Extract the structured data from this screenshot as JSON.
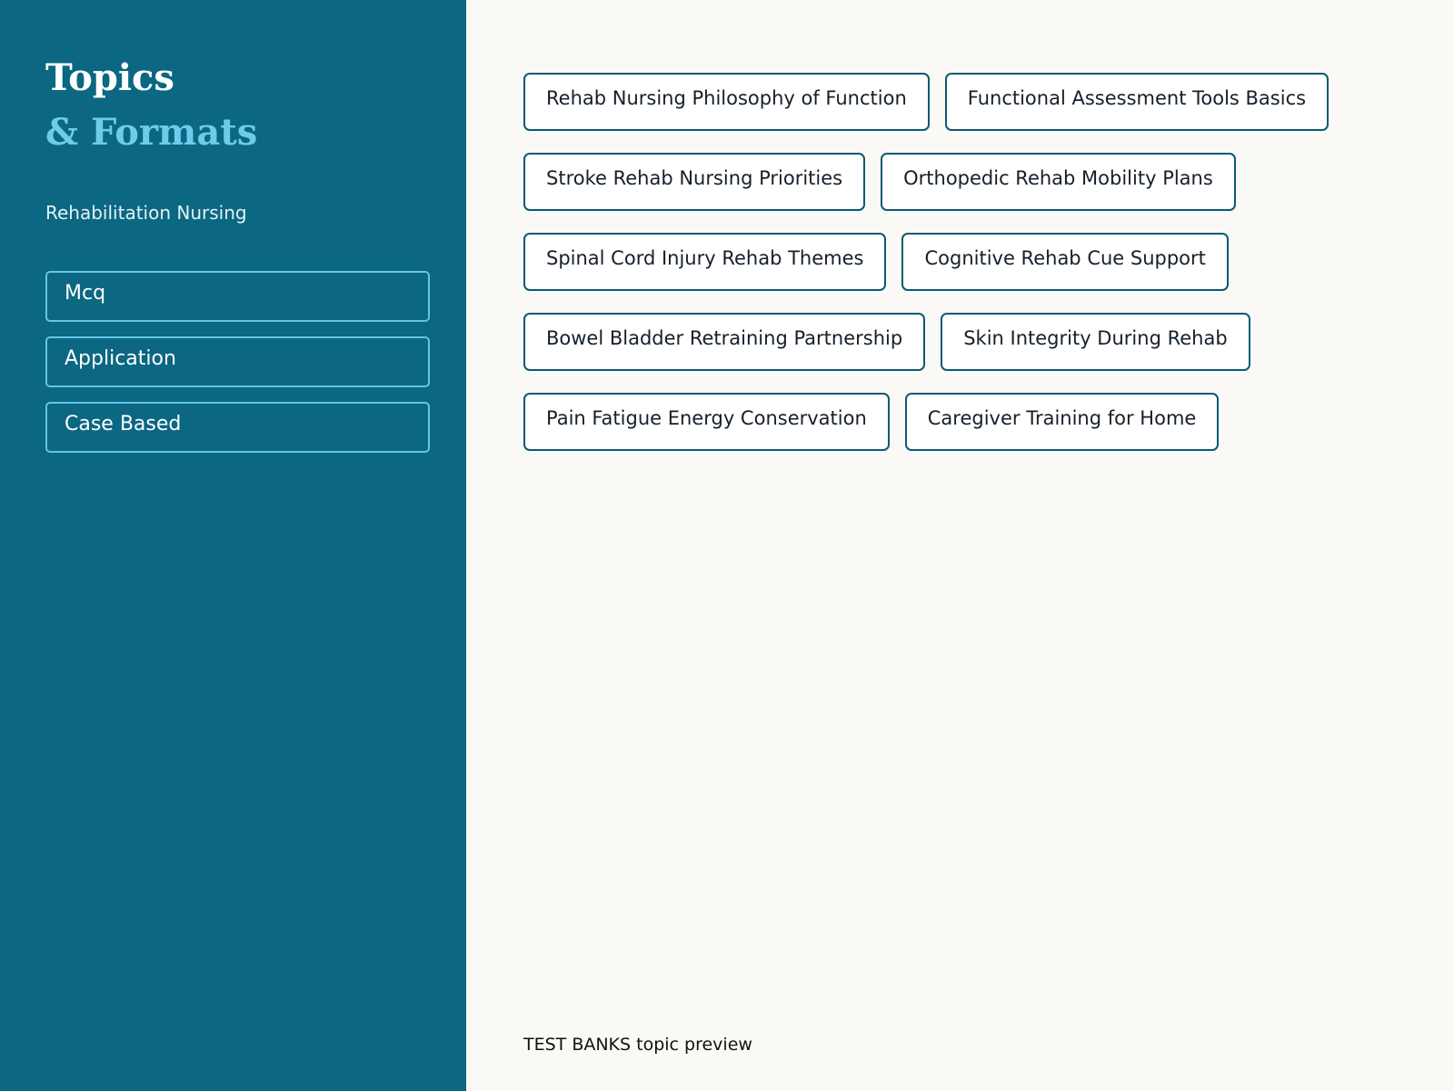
{
  "sidebar": {
    "title_line1": "Topics",
    "title_line2": "& Formats",
    "subtitle": "Rehabilitation Nursing",
    "formats": [
      "Mcq",
      "Application",
      "Case Based"
    ]
  },
  "main": {
    "topics": [
      "Rehab Nursing Philosophy of Function",
      "Functional Assessment Tools Basics",
      "Stroke Rehab Nursing Priorities",
      "Orthopedic Rehab Mobility Plans",
      "Spinal Cord Injury Rehab Themes",
      "Cognitive Rehab Cue Support",
      "Bowel Bladder Retraining Partnership",
      "Skin Integrity During Rehab",
      "Pain Fatigue Energy Conservation",
      "Caregiver Training for Home"
    ],
    "footer": "TEST BANKS topic preview"
  },
  "colors": {
    "sidebar_bg": "#0b6782",
    "accent": "#6ccdea",
    "chip_border": "#0b5a72",
    "page_bg": "#faf9f6"
  }
}
